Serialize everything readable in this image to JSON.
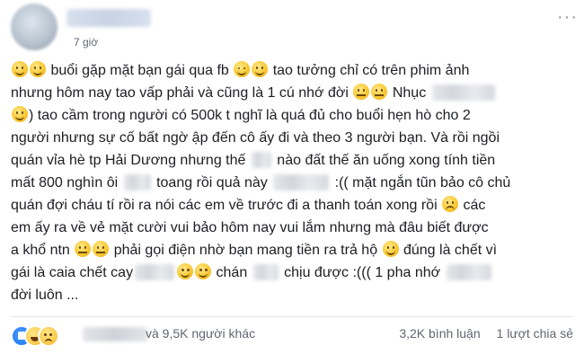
{
  "post": {
    "time": "7 giờ",
    "more_icon": "···",
    "lines": [
      [
        "e:smile",
        "e:smile",
        " buổi gặp mặt bạn gái qua fb ",
        "e:wink",
        "e:smile",
        " tao tưởng chỉ có trên phim ảnh"
      ],
      [
        "nhưng hôm nay tao vấp phải và cũng là 1 cú nhớ đời ",
        "e:flat",
        "e:flat",
        " Nhục ",
        "b:70"
      ],
      [
        "e:smile",
        ") tao cầm trong người có 500k t nghĩ là quá đủ cho buổi hẹn hò cho 2"
      ],
      [
        "người nhưng sự cố bất ngờ ập đến cô ấy đi và theo 3 người bạn. Và rồi ngồi"
      ],
      [
        "quán vỉa hè tp Hải Dương nhưng thế ",
        "b:22",
        " nào đất thế ăn uống xong tính tiền"
      ],
      [
        "mất 800 nghìn ôi ",
        "b:30",
        " toang rồi quả này ",
        "b:62",
        " :(( mặt ngắn tũn bảo cô chủ"
      ],
      [
        "quán đợi cháu tí rồi ra nói các em về trước đi a thanh toán xong rồi ",
        "e:sad",
        " các"
      ],
      [
        "em ấy ra về vẻ mặt cười vui bảo hôm nay vui lắm nhưng mà đâu biết được"
      ],
      [
        "a khổ ntn ",
        "e:flat",
        "e:flat",
        " phải gọi điện nhờ bạn mang tiền ra trả hộ ",
        "e:smile",
        " đúng là chết vì"
      ],
      [
        "gái là caia chết cay",
        "b:44",
        "e:up",
        "e:up",
        " chán ",
        "b:28",
        " chịu được :((( 1 pha nhớ ",
        "b:50"
      ],
      [
        "đời luôn ..."
      ]
    ]
  },
  "footer": {
    "reactions": [
      "like-icon",
      "haha-icon",
      "sad-icon"
    ],
    "reactors_text": "và 9,5K người khác",
    "comments": "3,2K bình luận",
    "shares": "1 lượt chia sẻ"
  }
}
